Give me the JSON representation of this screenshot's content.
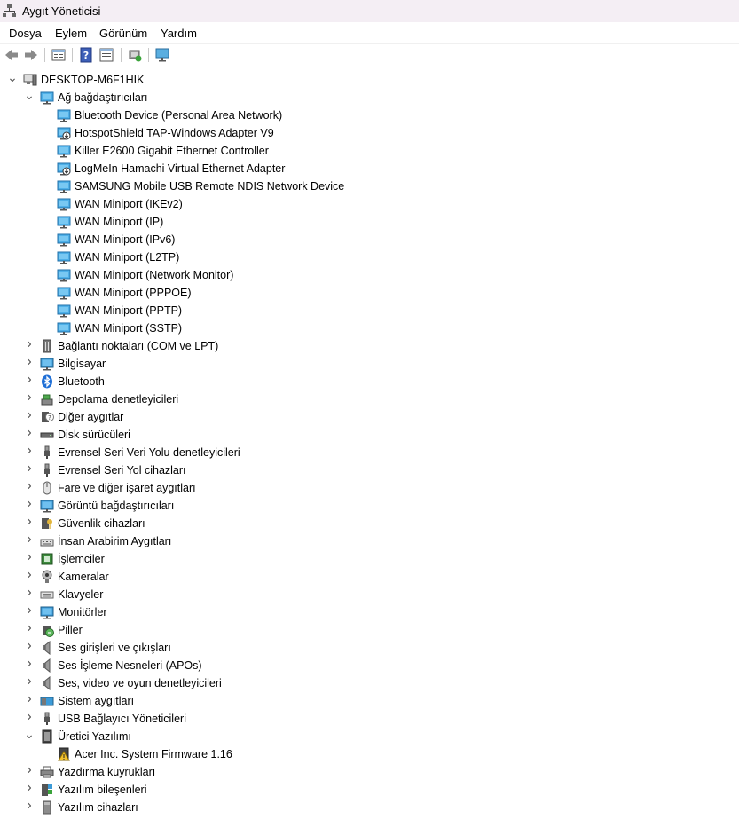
{
  "window": {
    "title": "Aygıt Yöneticisi"
  },
  "menu": [
    "Dosya",
    "Eylem",
    "Görünüm",
    "Yardım"
  ],
  "toolbar": [
    {
      "icon": "back-arrow-icon"
    },
    {
      "icon": "forward-arrow-icon"
    },
    {
      "icon": "properties-icon"
    },
    {
      "icon": "help-icon"
    },
    {
      "icon": "details-view-icon"
    },
    {
      "icon": "scan-hardware-icon"
    },
    {
      "icon": "monitor-display-icon"
    }
  ],
  "tree": {
    "root": "DESKTOP-M6F1HIK",
    "categories": [
      {
        "label": "Ağ bağdaştırıcıları",
        "icon": "network-adapter-icon",
        "expanded": true,
        "children": [
          {
            "label": "Bluetooth Device (Personal Area Network)",
            "icon": "network-adapter-icon"
          },
          {
            "label": "HotspotShield TAP-Windows Adapter V9",
            "icon": "network-adapter-down-icon"
          },
          {
            "label": "Killer E2600 Gigabit Ethernet Controller",
            "icon": "network-adapter-icon"
          },
          {
            "label": "LogMeIn Hamachi Virtual Ethernet Adapter",
            "icon": "network-adapter-down-icon"
          },
          {
            "label": "SAMSUNG Mobile USB Remote NDIS Network Device",
            "icon": "network-adapter-icon"
          },
          {
            "label": "WAN Miniport (IKEv2)",
            "icon": "network-adapter-icon"
          },
          {
            "label": "WAN Miniport (IP)",
            "icon": "network-adapter-icon"
          },
          {
            "label": "WAN Miniport (IPv6)",
            "icon": "network-adapter-icon"
          },
          {
            "label": "WAN Miniport (L2TP)",
            "icon": "network-adapter-icon"
          },
          {
            "label": "WAN Miniport (Network Monitor)",
            "icon": "network-adapter-icon"
          },
          {
            "label": "WAN Miniport (PPPOE)",
            "icon": "network-adapter-icon"
          },
          {
            "label": "WAN Miniport (PPTP)",
            "icon": "network-adapter-icon"
          },
          {
            "label": "WAN Miniport (SSTP)",
            "icon": "network-adapter-icon"
          }
        ]
      },
      {
        "label": "Bağlantı noktaları (COM ve LPT)",
        "icon": "port-icon",
        "expanded": false
      },
      {
        "label": "Bilgisayar",
        "icon": "computer-icon",
        "expanded": false
      },
      {
        "label": "Bluetooth",
        "icon": "bluetooth-icon",
        "expanded": false
      },
      {
        "label": "Depolama denetleyicileri",
        "icon": "storage-controller-icon",
        "expanded": false
      },
      {
        "label": "Diğer aygıtlar",
        "icon": "unknown-device-icon",
        "expanded": false
      },
      {
        "label": "Disk sürücüleri",
        "icon": "disk-drive-icon",
        "expanded": false
      },
      {
        "label": "Evrensel Seri Veri Yolu denetleyicileri",
        "icon": "usb-icon",
        "expanded": false
      },
      {
        "label": "Evrensel Seri Yol cihazları",
        "icon": "usb-icon",
        "expanded": false
      },
      {
        "label": "Fare ve diğer işaret aygıtları",
        "icon": "mouse-icon",
        "expanded": false
      },
      {
        "label": "Görüntü bağdaştırıcıları",
        "icon": "display-adapter-icon",
        "expanded": false
      },
      {
        "label": "Güvenlik cihazları",
        "icon": "security-device-icon",
        "expanded": false
      },
      {
        "label": "İnsan Arabirim Aygıtları",
        "icon": "hid-icon",
        "expanded": false
      },
      {
        "label": "İşlemciler",
        "icon": "processor-icon",
        "expanded": false
      },
      {
        "label": "Kameralar",
        "icon": "camera-icon",
        "expanded": false
      },
      {
        "label": "Klavyeler",
        "icon": "keyboard-icon",
        "expanded": false
      },
      {
        "label": "Monitörler",
        "icon": "monitor-icon",
        "expanded": false
      },
      {
        "label": "Piller",
        "icon": "battery-icon",
        "expanded": false
      },
      {
        "label": "Ses girişleri ve çıkışları",
        "icon": "speaker-icon",
        "expanded": false
      },
      {
        "label": "Ses İşleme Nesneleri (APOs)",
        "icon": "speaker-icon",
        "expanded": false
      },
      {
        "label": "Ses, video ve oyun denetleyicileri",
        "icon": "speaker-icon",
        "expanded": false
      },
      {
        "label": "Sistem aygıtları",
        "icon": "system-device-icon",
        "expanded": false
      },
      {
        "label": "USB Bağlayıcı Yöneticileri",
        "icon": "usb-icon",
        "expanded": false
      },
      {
        "label": "Üretici Yazılımı",
        "icon": "firmware-icon",
        "expanded": true,
        "children": [
          {
            "label": "Acer Inc. System Firmware 1.16",
            "icon": "firmware-warning-icon"
          }
        ]
      },
      {
        "label": "Yazdırma kuyrukları",
        "icon": "printer-icon",
        "expanded": false
      },
      {
        "label": "Yazılım bileşenleri",
        "icon": "software-component-icon",
        "expanded": false
      },
      {
        "label": "Yazılım cihazları",
        "icon": "software-device-icon",
        "expanded": false
      }
    ]
  }
}
